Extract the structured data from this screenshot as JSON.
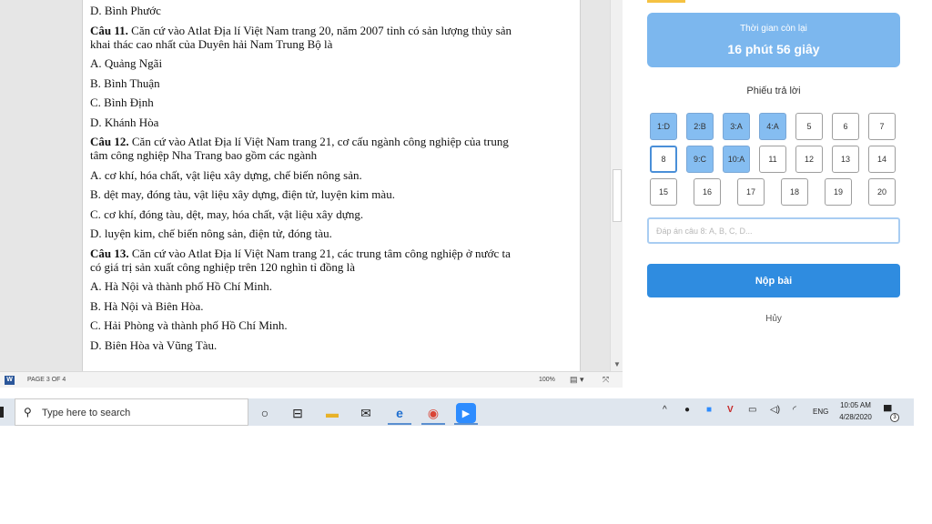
{
  "document": {
    "paragraphs": [
      {
        "bold": "",
        "text": "D. Bình Phước"
      },
      {
        "bold": "Câu 11.",
        "text": " Căn cứ vào Atlat Địa lí Việt Nam trang 20, năm 2007 tỉnh có sản lượng thủy sản khai thác cao nhất của Duyên hải Nam Trung Bộ là"
      },
      {
        "bold": "",
        "text": "A. Quảng Ngãi"
      },
      {
        "bold": "",
        "text": "B. Bình Thuận"
      },
      {
        "bold": "",
        "text": "C. Bình Định"
      },
      {
        "bold": "",
        "text": "D. Khánh Hòa"
      },
      {
        "bold": "Câu 12.",
        "text": " Căn cứ vào Atlat Địa lí Việt Nam trang 21, cơ cấu ngành công nghiệp của trung tâm công nghiệp Nha Trang bao gồm các ngành"
      },
      {
        "bold": "",
        "text": "A. cơ khí, hóa chất, vật liệu xây dựng, chế biến nông sản."
      },
      {
        "bold": "",
        "text": "B. dệt may, đóng tàu, vật liệu xây dựng, điện tử, luyện kim màu."
      },
      {
        "bold": "",
        "text": "C. cơ khí, đóng tàu, dệt, may, hóa chất, vật liệu xây dựng."
      },
      {
        "bold": "",
        "text": "D. luyện kim, chế biến nông sản, điện tử, đóng tàu."
      },
      {
        "bold": "Câu 13.",
        "text": " Căn cứ vào Atlat Địa lí Việt Nam trang 21, các trung tâm công nghiệp ở nước ta có giá trị sản xuất công nghiệp trên 120 nghìn tỉ đồng là"
      },
      {
        "bold": "",
        "text": "A. Hà Nội và thành phố Hồ Chí Minh."
      },
      {
        "bold": "",
        "text": "B. Hà Nội và Biên Hòa."
      },
      {
        "bold": "",
        "text": "C. Hải Phòng và thành phố Hồ Chí Minh."
      },
      {
        "bold": "",
        "text": "D. Biên Hòa và Vũng Tàu."
      }
    ]
  },
  "word_status": {
    "page_indicator": "PAGE 3 OF 4",
    "zoom": "100%",
    "app_icon_letter": "W"
  },
  "exam": {
    "timer_label": "Thời gian còn lại",
    "timer_value": "16 phút 56 giây",
    "sheet_title": "Phiếu trả lời",
    "answers": [
      {
        "label": "1:D",
        "state": "answered"
      },
      {
        "label": "2:B",
        "state": "answered"
      },
      {
        "label": "3:A",
        "state": "answered"
      },
      {
        "label": "4:A",
        "state": "answered"
      },
      {
        "label": "5",
        "state": "empty"
      },
      {
        "label": "6",
        "state": "empty"
      },
      {
        "label": "7",
        "state": "empty"
      },
      {
        "label": "8",
        "state": "current"
      },
      {
        "label": "9:C",
        "state": "answered"
      },
      {
        "label": "10:A",
        "state": "answered"
      },
      {
        "label": "11",
        "state": "empty"
      },
      {
        "label": "12",
        "state": "empty"
      },
      {
        "label": "13",
        "state": "empty"
      },
      {
        "label": "14",
        "state": "empty"
      },
      {
        "label": "15",
        "state": "empty"
      },
      {
        "label": "16",
        "state": "empty"
      },
      {
        "label": "17",
        "state": "empty"
      },
      {
        "label": "18",
        "state": "empty"
      },
      {
        "label": "19",
        "state": "empty"
      },
      {
        "label": "20",
        "state": "empty"
      }
    ],
    "input_placeholder": "Đáp án câu 8: A, B, C, D...",
    "submit_label": "Nộp bài",
    "cancel_label": "Hủy",
    "colors": {
      "timer_bg": "#7cb7ee",
      "answered_bg": "#85bdf1",
      "submit_bg": "#2f8ce0",
      "badge": "#f5c242"
    }
  },
  "taskbar": {
    "search_placeholder": "Type here to search",
    "language": "ENG",
    "time": "10:05 AM",
    "date": "4/28/2020",
    "notification_count": "3",
    "pinned_icons": [
      "cortana-icon",
      "task-view-icon",
      "file-explorer-icon",
      "mail-icon",
      "edge-icon",
      "chrome-icon",
      "zoom-icon"
    ]
  }
}
